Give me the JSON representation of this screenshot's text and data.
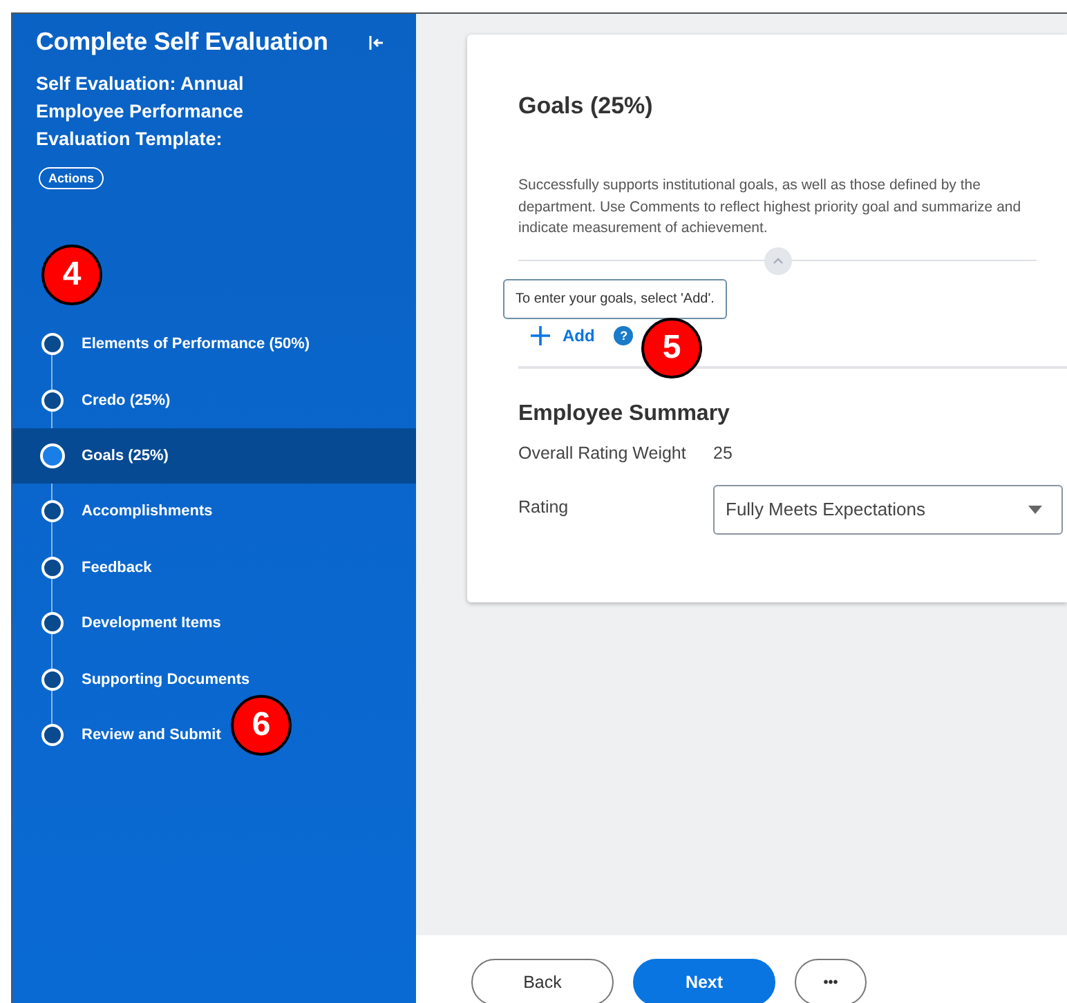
{
  "sidebar": {
    "title": "Complete Self Evaluation",
    "subtitle": "Self Evaluation: Annual Employee Performance Evaluation Template:",
    "actions_button": "Actions",
    "steps": [
      {
        "label": "Elements of Performance (50%)",
        "selected": false
      },
      {
        "label": "Credo (25%)",
        "selected": false
      },
      {
        "label": "Goals (25%)",
        "selected": true
      },
      {
        "label": "Accomplishments",
        "selected": false
      },
      {
        "label": "Feedback",
        "selected": false
      },
      {
        "label": "Development Items",
        "selected": false
      },
      {
        "label": "Supporting Documents",
        "selected": false
      },
      {
        "label": "Review and Submit",
        "selected": false
      }
    ]
  },
  "card": {
    "title": "Goals (25%)",
    "description": "Successfully supports institutional goals, as well as those defined by the department. Use Comments to reflect highest priority goal and summarize and indicate measurement of achievement.",
    "tooltip": "To enter your goals, select 'Add'.",
    "add_button": "Add",
    "help_icon": "?",
    "summary_title": "Employee Summary",
    "overall_label": "Overall Rating Weight",
    "overall_value": "25",
    "rating_label": "Rating",
    "rating_value": "Fully Meets Expectations"
  },
  "footer": {
    "buttons": [
      {
        "label": "Back",
        "kind": "outline"
      },
      {
        "label": "Next",
        "kind": "primary"
      },
      {
        "label": "•••",
        "kind": "more"
      }
    ]
  },
  "callouts": [
    "4",
    "5",
    "6"
  ]
}
